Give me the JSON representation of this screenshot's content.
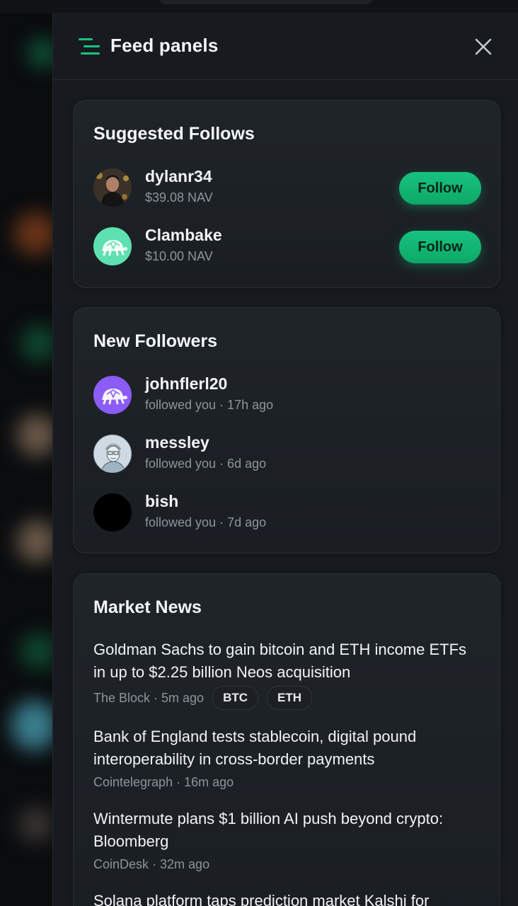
{
  "drawer": {
    "title": "Feed panels"
  },
  "suggested": {
    "title": "Suggested Follows",
    "items": [
      {
        "name": "dylanr34",
        "sub": "$39.08 NAV",
        "button": "Follow",
        "avatar": "photo-avatar"
      },
      {
        "name": "Clambake",
        "sub": "$10.00 NAV",
        "button": "Follow",
        "avatar": "turtle-icon",
        "avatar_color": "#5fe0b0"
      }
    ]
  },
  "followers": {
    "title": "New Followers",
    "items": [
      {
        "name": "johnflerl20",
        "sub": "followed you · 17h ago",
        "avatar": "turtle-icon",
        "avatar_color": "#8b5cf6"
      },
      {
        "name": "messley",
        "sub": "followed you · 6d ago",
        "avatar": "sketch-portrait"
      },
      {
        "name": "bish",
        "sub": "followed you · 7d ago",
        "avatar": "black-circle"
      }
    ]
  },
  "news": {
    "title": "Market News",
    "items": [
      {
        "headline": "Goldman Sachs to gain bitcoin and ETH income ETFs in up to $2.25 billion Neos acquisition",
        "meta": "The Block · 5m ago",
        "tags": [
          "BTC",
          "ETH"
        ]
      },
      {
        "headline": "Bank of England tests stablecoin, digital pound interoperability in cross-border payments",
        "meta": "Cointelegraph · 16m ago",
        "tags": []
      },
      {
        "headline": "Wintermute plans $1 billion AI push beyond crypto: Bloomberg",
        "meta": "CoinDesk · 32m ago",
        "tags": []
      },
      {
        "headline": "Solana platform taps prediction market Kalshi for",
        "meta": "",
        "tags": []
      }
    ]
  },
  "colors": {
    "accent": "#17c37f",
    "panel": "#171b20",
    "card": "#1f2429"
  }
}
